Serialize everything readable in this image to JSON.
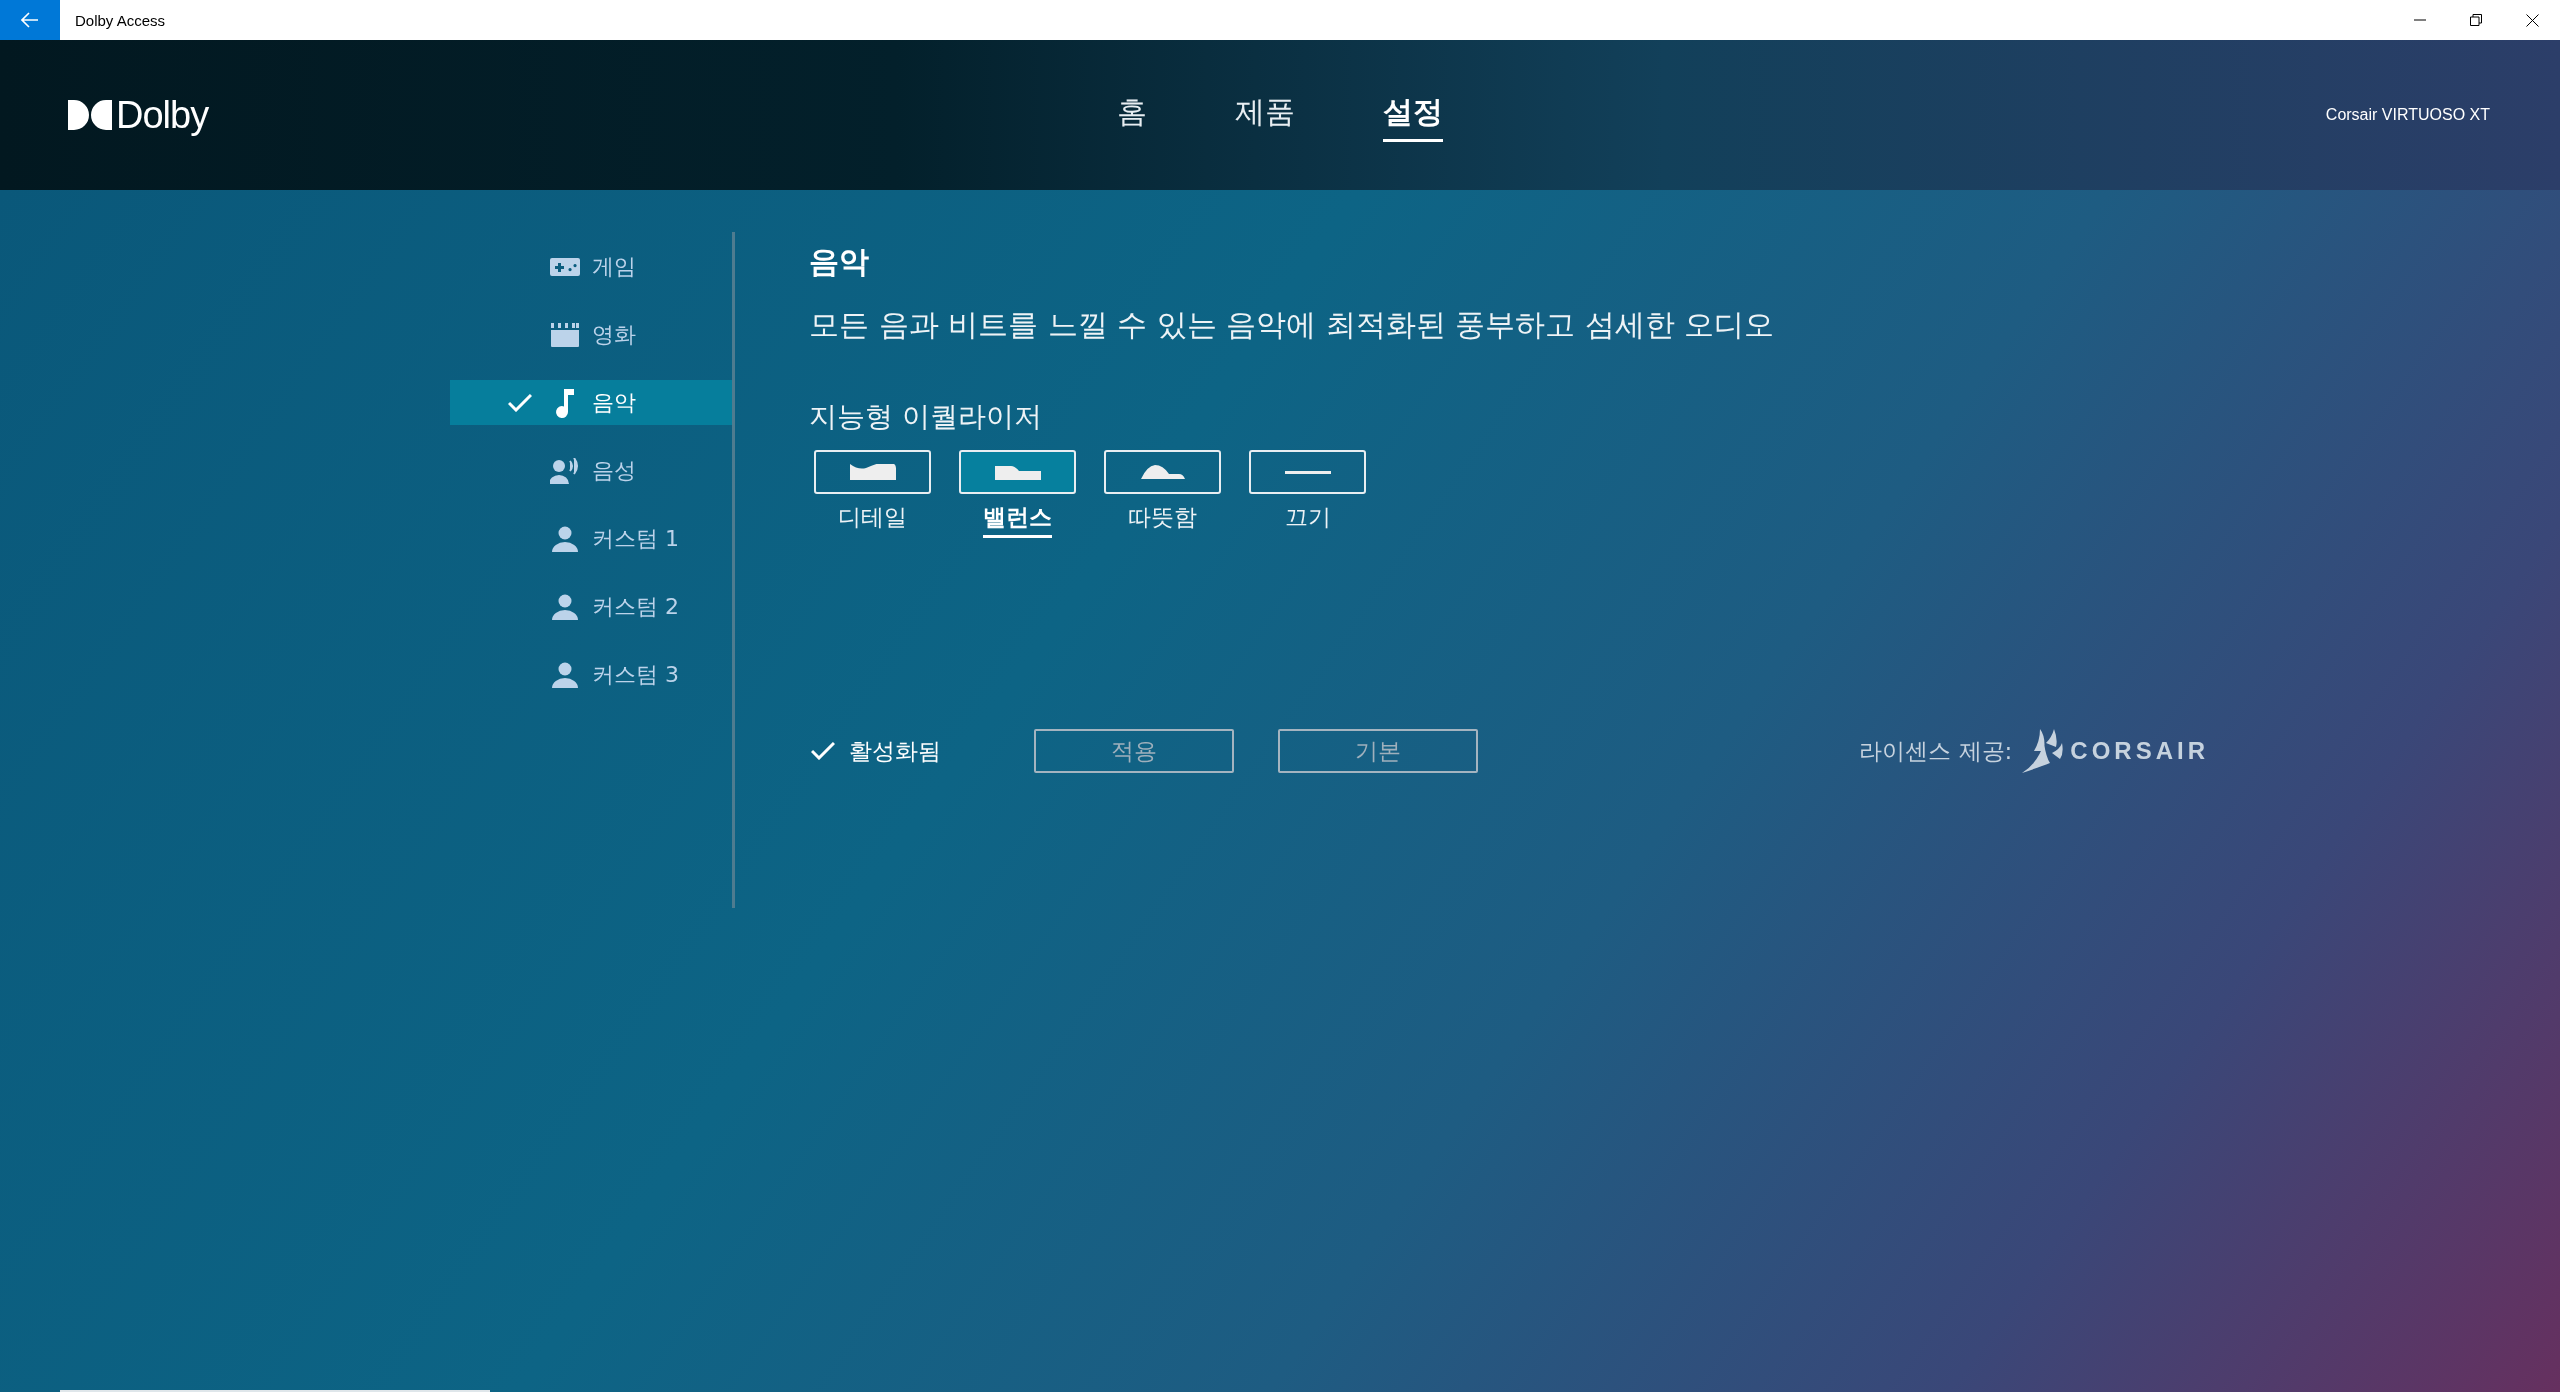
{
  "window": {
    "title": "Dolby Access"
  },
  "header": {
    "logo": "Dolby",
    "device": "Corsair VIRTUOSO XT"
  },
  "tabs": [
    {
      "label": "홈",
      "selected": false
    },
    {
      "label": "제품",
      "selected": false
    },
    {
      "label": "설정",
      "selected": true
    }
  ],
  "sidebar": {
    "items": [
      {
        "kind": "game",
        "label": "게임",
        "selected": false
      },
      {
        "kind": "movie",
        "label": "영화",
        "selected": false
      },
      {
        "kind": "music",
        "label": "음악",
        "selected": true
      },
      {
        "kind": "voice",
        "label": "음성",
        "selected": false
      },
      {
        "kind": "custom",
        "label": "커스텀 1",
        "selected": false
      },
      {
        "kind": "custom",
        "label": "커스텀 2",
        "selected": false
      },
      {
        "kind": "custom",
        "label": "커스텀 3",
        "selected": false
      }
    ]
  },
  "profile": {
    "title": "음악",
    "description": "모든 음과 비트를 느낄 수 있는 음악에 최적화된 풍부하고 섬세한 오디오",
    "equalizer_title": "지능형 이퀄라이저",
    "presets": [
      {
        "kind": "detail",
        "label": "디테일",
        "selected": false
      },
      {
        "kind": "balanced",
        "label": "밸런스",
        "selected": true
      },
      {
        "kind": "warm",
        "label": "따뜻함",
        "selected": false
      },
      {
        "kind": "off",
        "label": "끄기",
        "selected": false
      }
    ]
  },
  "footer": {
    "enabled": {
      "label": "활성화됨",
      "checked": true
    },
    "buttons": [
      {
        "label": "적용",
        "disabled": true
      },
      {
        "label": "기본",
        "disabled": true
      }
    ],
    "license": "라이센스 제공:",
    "brand": "CORSAIR"
  }
}
